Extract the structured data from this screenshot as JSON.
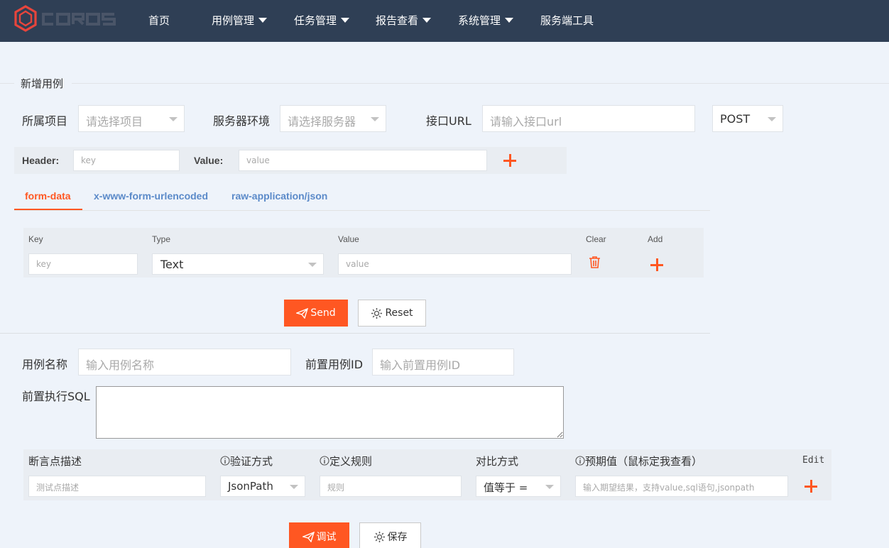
{
  "brand": {
    "logo_text": "COROS",
    "accent": "#ff5722",
    "nav_bg": "#2f3f55"
  },
  "nav": {
    "items": [
      {
        "label": "首页",
        "has_dropdown": false
      },
      {
        "label": "用例管理",
        "has_dropdown": true
      },
      {
        "label": "任务管理",
        "has_dropdown": true
      },
      {
        "label": "报告查看",
        "has_dropdown": true
      },
      {
        "label": "系统管理",
        "has_dropdown": true
      },
      {
        "label": "服务端工具",
        "has_dropdown": false
      }
    ]
  },
  "form": {
    "legend": "新增用例",
    "project_label": "所属项目",
    "project_placeholder": "请选择项目",
    "server_label": "服务器环境",
    "server_placeholder": "请选择服务器",
    "url_label": "接口URL",
    "url_placeholder": "请输入接口url",
    "method_value": "POST"
  },
  "header_row": {
    "header_label": "Header:",
    "key_placeholder": "key",
    "value_label": "Value:",
    "value_placeholder": "value"
  },
  "tabs": [
    {
      "label": "form-data",
      "active": true
    },
    {
      "label": "x-www-form-urlencoded",
      "active": false
    },
    {
      "label": "raw-application/json",
      "active": false
    }
  ],
  "params_table": {
    "headers": {
      "key": "Key",
      "type": "Type",
      "value": "Value",
      "clear": "Clear",
      "add": "Add"
    },
    "row": {
      "key_placeholder": "key",
      "type_value": "Text",
      "value_placeholder": "value"
    }
  },
  "buttons": {
    "send": "Send",
    "reset": "Reset",
    "debug": "调试",
    "save": "保存"
  },
  "case": {
    "name_label": "用例名称",
    "name_placeholder": "输入用例名称",
    "pre_id_label": "前置用例ID",
    "pre_id_placeholder": "输入前置用例ID",
    "sql_label": "前置执行SQL"
  },
  "assert_table": {
    "headers": {
      "desc": "断言点描述",
      "verify": "验证方式",
      "rule": "定义规则",
      "compare": "对比方式",
      "expected": "预期值（鼠标定我查看）",
      "edit": "Edit"
    },
    "row": {
      "desc_placeholder": "测试点描述",
      "verify_value": "JsonPath",
      "rule_placeholder": "规则",
      "compare_value": "值等于 =",
      "expected_placeholder": "输入期望结果，支持value,sql语句,jsonpath"
    }
  }
}
